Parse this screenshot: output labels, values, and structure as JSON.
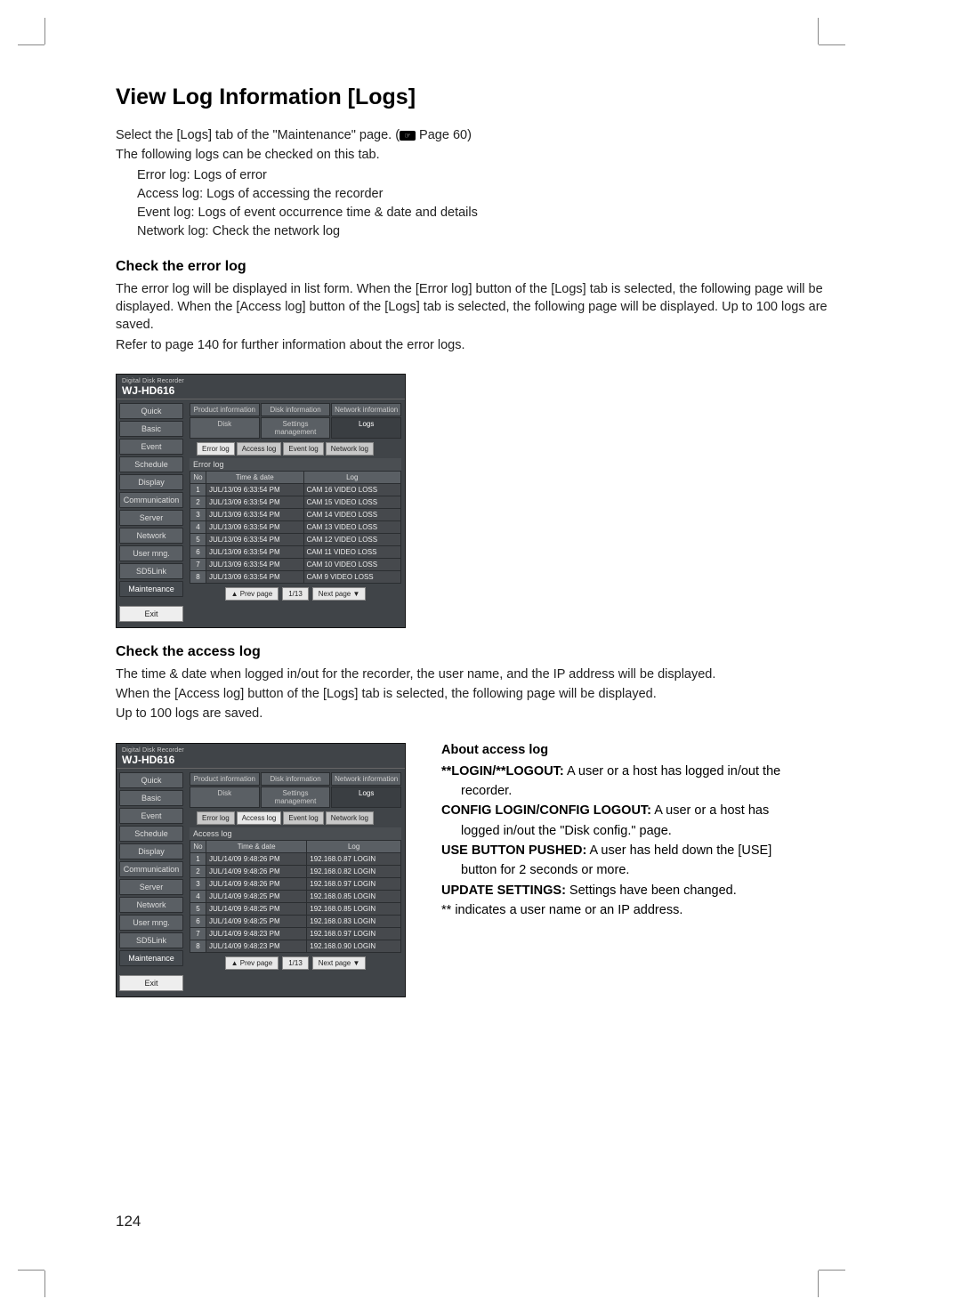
{
  "page_number": "124",
  "title": "View Log Information [Logs]",
  "intro_line1_a": "Select the [Logs] tab of the \"Maintenance\" page. (",
  "intro_line1_b": " Page 60)",
  "intro_line2": "The following logs can be checked on this tab.",
  "log_types": {
    "a": "Error log: Logs of error",
    "b": "Access log: Logs of accessing the recorder",
    "c": "Event log: Logs of event occurrence time & date and details",
    "d": "Network log: Check the network log"
  },
  "section1": {
    "heading": "Check the error log",
    "p1": "The error log will be displayed in list form. When the [Error log] button of the [Logs] tab is selected, the following page will be displayed. When the [Access log] button of the [Logs] tab is selected, the following page will be displayed. Up to 100 logs are saved.",
    "p2": "Refer to page 140 for further information about the error logs."
  },
  "section2": {
    "heading": "Check the access log",
    "p1": "The time & date when logged in/out for the recorder, the user name, and the IP address will be displayed.",
    "p2": "When the [Access log] button of the [Logs] tab is selected, the following page will be displayed.",
    "p3": "Up to 100 logs are saved."
  },
  "about": {
    "title": "About access log",
    "r1_lead": "**LOGIN/**LOGOUT:",
    "r1_text": " A user or a host has logged in/out the",
    "r1_cont": "recorder.",
    "r2_lead": "CONFIG LOGIN/CONFIG LOGOUT:",
    "r2_text": " A user or a host has",
    "r2_cont": "logged in/out the \"Disk config.\" page.",
    "r3_lead": "USE BUTTON PUSHED:",
    "r3_text": " A user has held down the [USE]",
    "r3_cont": "button for 2 seconds or more.",
    "r4_lead": "UPDATE SETTINGS:",
    "r4_text": " Settings have been changed.",
    "note": "** indicates a user name or an IP address."
  },
  "scr": {
    "super": "Digital Disk Recorder",
    "model": "WJ-HD616",
    "side": [
      "Quick",
      "Basic",
      "Event",
      "Schedule",
      "Display",
      "Communication",
      "Server",
      "Network",
      "User mng.",
      "SD5Link",
      "Maintenance"
    ],
    "exit": "Exit",
    "tabs_row1": [
      "Product information",
      "Disk information",
      "Network information"
    ],
    "tabs_row2": [
      "Disk",
      "Settings management",
      "Logs"
    ],
    "subtabs": [
      "Error log",
      "Access log",
      "Event log",
      "Network log"
    ],
    "pager_prev": "▲ Prev page",
    "pager_count": "1/13",
    "pager_next": "Next page ▼",
    "th_no": "No",
    "th_time": "Time & date",
    "th_log": "Log"
  },
  "error_log": {
    "section_label": "Error log",
    "rows": [
      {
        "n": "1",
        "t": "JUL/13/09  6:33:54 PM",
        "l": "CAM 16 VIDEO LOSS"
      },
      {
        "n": "2",
        "t": "JUL/13/09  6:33:54 PM",
        "l": "CAM 15 VIDEO LOSS"
      },
      {
        "n": "3",
        "t": "JUL/13/09  6:33:54 PM",
        "l": "CAM 14 VIDEO LOSS"
      },
      {
        "n": "4",
        "t": "JUL/13/09  6:33:54 PM",
        "l": "CAM 13 VIDEO LOSS"
      },
      {
        "n": "5",
        "t": "JUL/13/09  6:33:54 PM",
        "l": "CAM 12 VIDEO LOSS"
      },
      {
        "n": "6",
        "t": "JUL/13/09  6:33:54 PM",
        "l": "CAM 11 VIDEO LOSS"
      },
      {
        "n": "7",
        "t": "JUL/13/09  6:33:54 PM",
        "l": "CAM 10 VIDEO LOSS"
      },
      {
        "n": "8",
        "t": "JUL/13/09  6:33:54 PM",
        "l": "CAM 9 VIDEO LOSS"
      }
    ]
  },
  "access_log": {
    "section_label": "Access log",
    "rows": [
      {
        "n": "1",
        "t": "JUL/14/09  9:48:26 PM",
        "l": "192.168.0.87 LOGIN"
      },
      {
        "n": "2",
        "t": "JUL/14/09  9:48:26 PM",
        "l": "192.168.0.82 LOGIN"
      },
      {
        "n": "3",
        "t": "JUL/14/09  9:48:26 PM",
        "l": "192.168.0.97 LOGIN"
      },
      {
        "n": "4",
        "t": "JUL/14/09  9:48:25 PM",
        "l": "192.168.0.85 LOGIN"
      },
      {
        "n": "5",
        "t": "JUL/14/09  9:48:25 PM",
        "l": "192.168.0.85 LOGIN"
      },
      {
        "n": "6",
        "t": "JUL/14/09  9:48:25 PM",
        "l": "192.168.0.83 LOGIN"
      },
      {
        "n": "7",
        "t": "JUL/14/09  9:48:23 PM",
        "l": "192.168.0.97 LOGIN"
      },
      {
        "n": "8",
        "t": "JUL/14/09  9:48:23 PM",
        "l": "192.168.0.90 LOGIN"
      }
    ]
  }
}
